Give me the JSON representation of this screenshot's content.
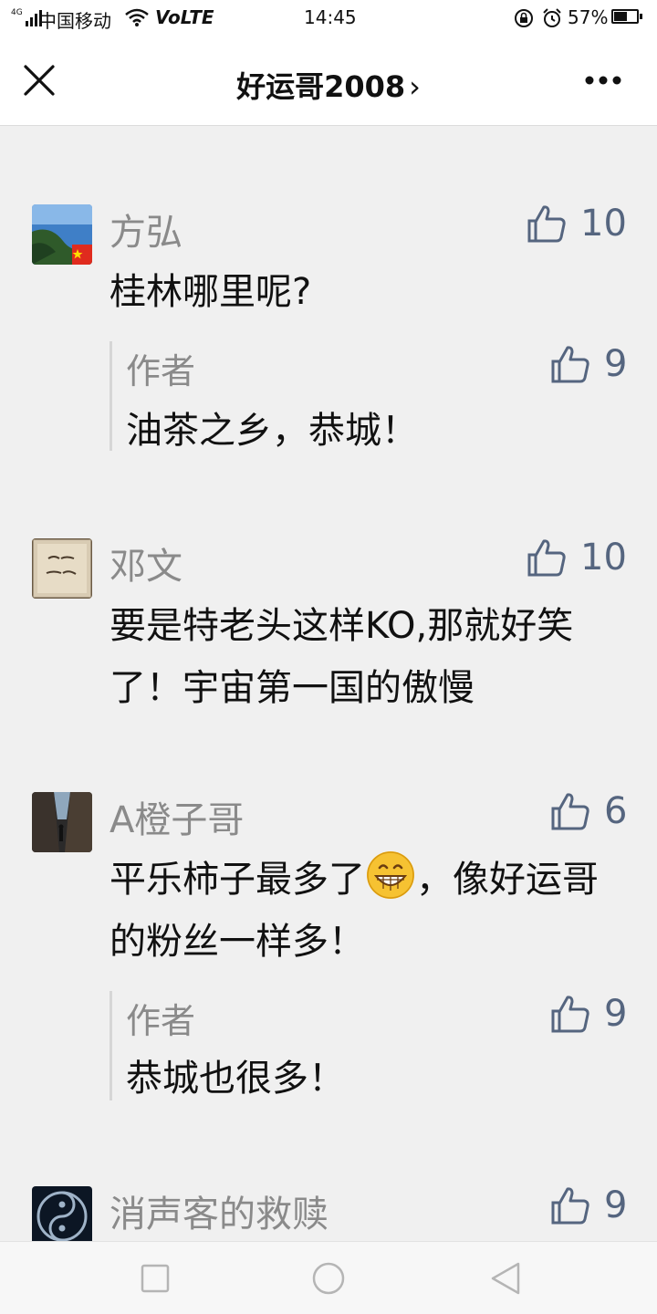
{
  "status_bar": {
    "network_type": "4G",
    "carrier": "中国移动",
    "volte": "VoLTE",
    "time": "14:45",
    "battery_percent": "57%",
    "battery_level": 0.57
  },
  "header": {
    "title": "好运哥2008",
    "title_chevron": "›"
  },
  "comments": [
    {
      "author": "方弘",
      "likes": "10",
      "text": "桂林哪里呢?",
      "reply": {
        "author": "作者",
        "likes": "9",
        "text": "油茶之乡，恭城！"
      }
    },
    {
      "author": "邓文",
      "likes": "10",
      "text": "要是特老头这样KO,那就好笑了！宇宙第一国的傲慢"
    },
    {
      "author": "A橙子哥",
      "likes": "6",
      "text_part1": "平乐柿子最多了",
      "text_part2": "，像好运哥的粉丝一样多！",
      "reply": {
        "author": "作者",
        "likes": "9",
        "text": "恭城也很多！"
      }
    },
    {
      "author": "消声客的救赎",
      "likes": "9"
    }
  ],
  "icons": {
    "like": "thumbs-up-icon",
    "close": "close-icon",
    "more": "more-icon",
    "emoji": "grinning-face-emoji"
  },
  "colors": {
    "like_color": "#55657f",
    "name_color": "#8a8a8a",
    "background": "#f0f0f0"
  }
}
